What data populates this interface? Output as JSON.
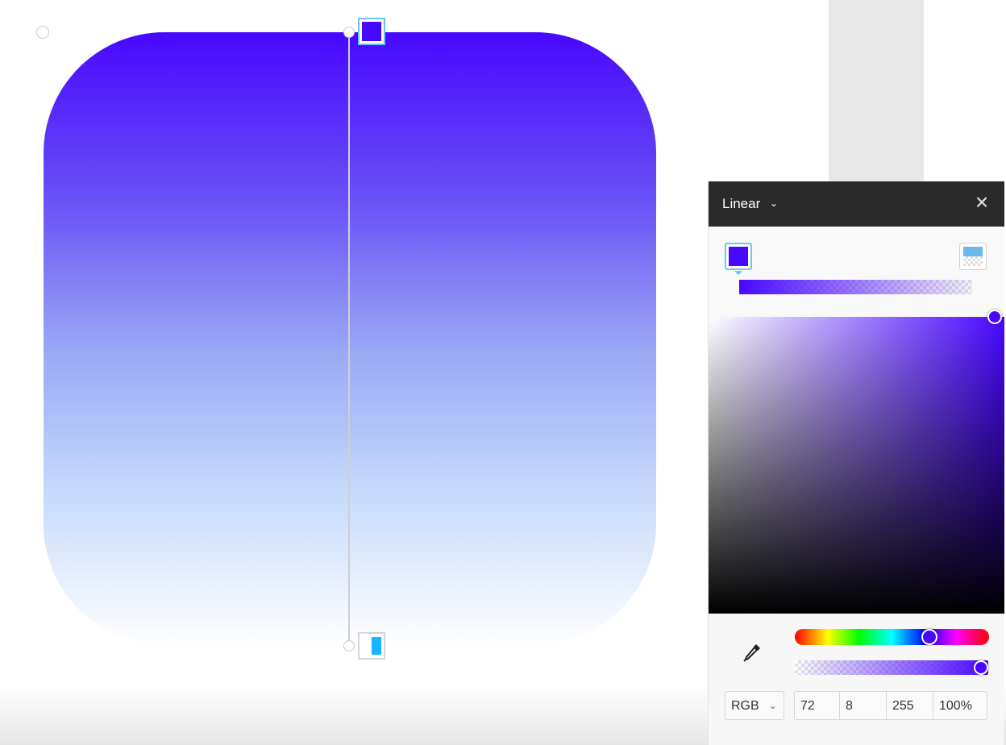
{
  "colors": {
    "start_stop": "#4808ff",
    "end_stop": "#17b4ff",
    "selection_accent": "#6bc4f4",
    "panel_header": "#2a2a2a"
  },
  "canvas": {
    "shape_fill": "linear-gradient",
    "gradient_stops": [
      "#4808ff",
      "#ffffff"
    ]
  },
  "color_panel": {
    "fill_type": "Linear",
    "icons": {
      "chevron": "chevron-down-icon",
      "close": "close-icon",
      "eyedropper": "eyedropper-icon"
    },
    "selected_stop_color": "#4808ff",
    "color_mode": "RGB",
    "values": {
      "r": "72",
      "g": "8",
      "b": "255",
      "alpha": "100%"
    },
    "hue_level": 0.7,
    "alpha_level": 1.0
  }
}
